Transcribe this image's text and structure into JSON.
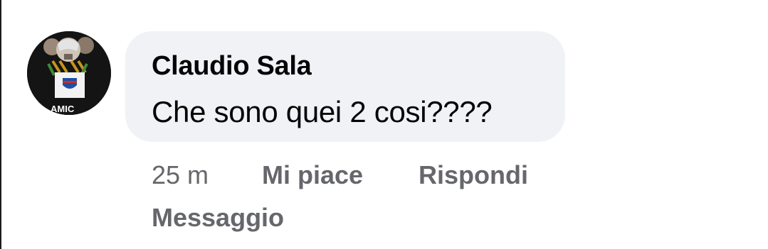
{
  "comment": {
    "author": "Claudio Sala",
    "text": "Che sono quei 2 cosi????",
    "avatar_caption": "AMIC"
  },
  "actions": {
    "time": "25 m",
    "like_label": "Mi piace",
    "reply_label": "Rispondi",
    "message_label": "Messaggio"
  },
  "colors": {
    "bubble_background": "#f0f2f5",
    "primary_text": "#050505",
    "secondary_text": "#65676b"
  },
  "icons": {
    "avatar": "profile-picture-icon"
  }
}
